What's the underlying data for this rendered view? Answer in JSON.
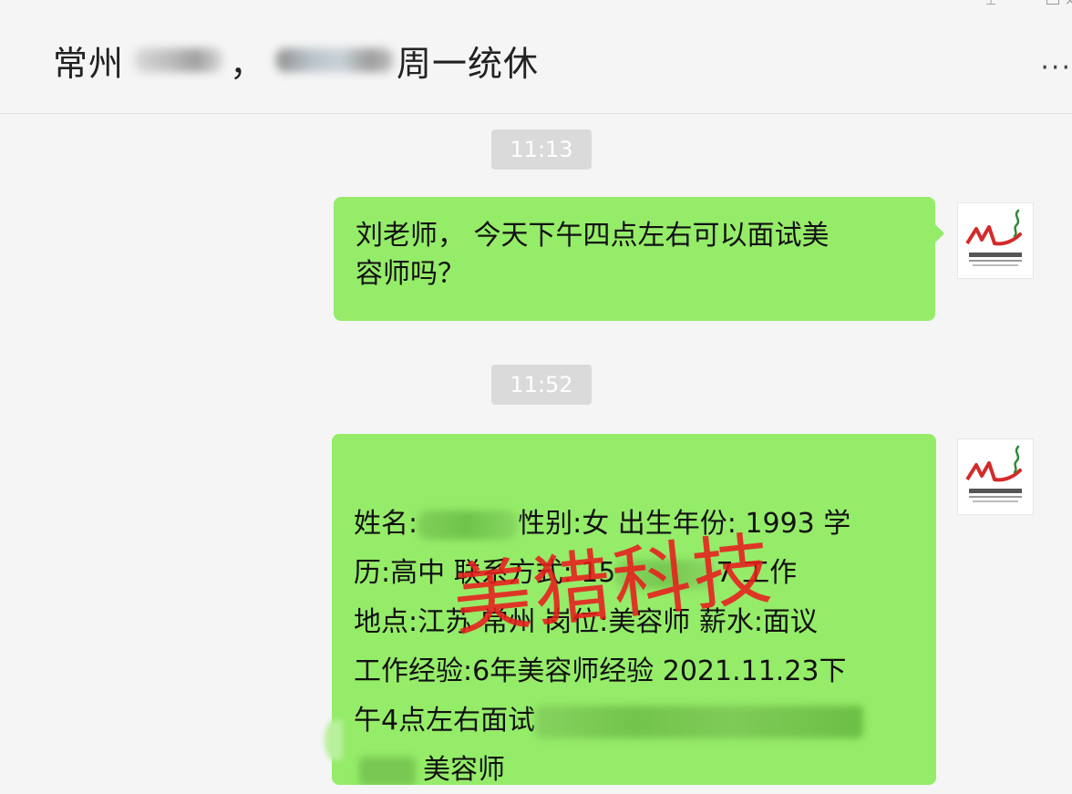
{
  "header": {
    "title_prefix": "常州",
    "title_separator": "，",
    "title_suffix": "周一统休",
    "more_label": "···"
  },
  "window_controls": {
    "pin": "pin-icon",
    "maximize": "maximize-icon",
    "close": "close-icon"
  },
  "messages": [
    {
      "timestamp": "11:13",
      "text_line1": "刘老师， 今天下午四点左右可以面试美",
      "text_line2": "容师吗？"
    },
    {
      "timestamp": "11:52",
      "line1_a": "姓名:",
      "line1_b": "性别:女 出生年份: 1993 学",
      "line2_a": "历:高中 联系方式: 15",
      "line2_b": "7 工作",
      "line3": "地点:江苏 常州 岗位:美容师 薪水:面议",
      "line4": "工作经验:6年美容师经验 2021.11.23下",
      "line5": "午4点左右面试",
      "line6": "美容师"
    }
  ],
  "watermark": {
    "text": "美猎科技",
    "color": "#e81c1c"
  },
  "colors": {
    "bubble": "#95ec69",
    "background": "#f5f5f5",
    "timestamp_bg": "#dadada"
  }
}
